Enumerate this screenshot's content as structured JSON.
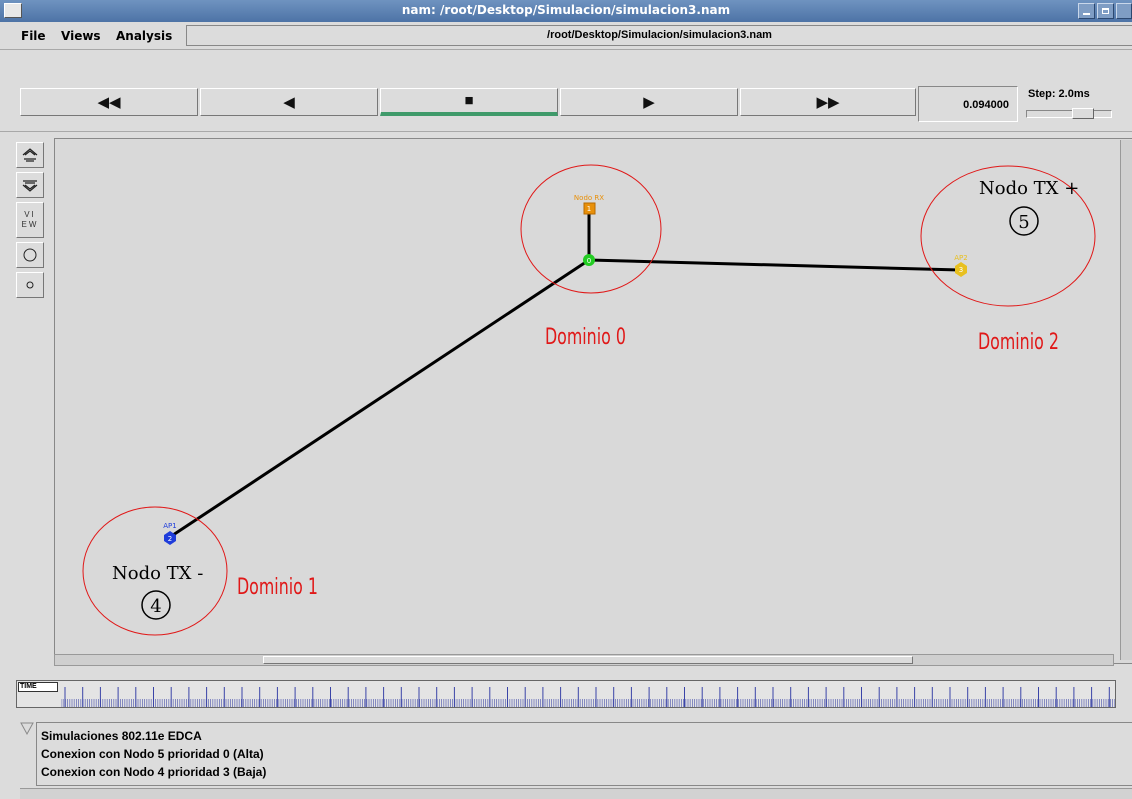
{
  "window": {
    "title": "nam: /root/Desktop/Simulacion/simulacion3.nam"
  },
  "menu": {
    "file": "File",
    "views": "Views",
    "analysis": "Analysis",
    "path": "/root/Desktop/Simulacion/simulacion3.nam"
  },
  "controls": {
    "rewind": "◀◀",
    "back": "◀",
    "stop": "■",
    "play": "▶",
    "fast_forward": "▶▶",
    "time": "0.094000",
    "step": "Step: 2.0ms"
  },
  "tools": {
    "view_label": "VI EW"
  },
  "topology": {
    "domains": [
      {
        "label": "Dominio 0"
      },
      {
        "label": "Dominio 1"
      },
      {
        "label": "Dominio 2"
      }
    ],
    "nodes": [
      {
        "id": "0",
        "label": "",
        "color": "#22cc22"
      },
      {
        "id": "1",
        "label": "Nodo RX",
        "color": "#e8900a"
      },
      {
        "id": "2",
        "label": "AP1",
        "color": "#1f3ddb"
      },
      {
        "id": "3",
        "label": "AP2",
        "color": "#e8c020"
      }
    ],
    "tx_minus": {
      "label": "Nodo TX -",
      "number": "4"
    },
    "tx_plus": {
      "label": "Nodo TX +",
      "number": "5"
    },
    "domain_color": "#e01818"
  },
  "timeline": {
    "label": "TIME"
  },
  "annotations": [
    "Simulaciones 802.11e EDCA",
    "Conexion con Nodo 5 prioridad 0 (Alta)",
    "Conexion con Nodo 4 prioridad 3 (Baja)"
  ]
}
